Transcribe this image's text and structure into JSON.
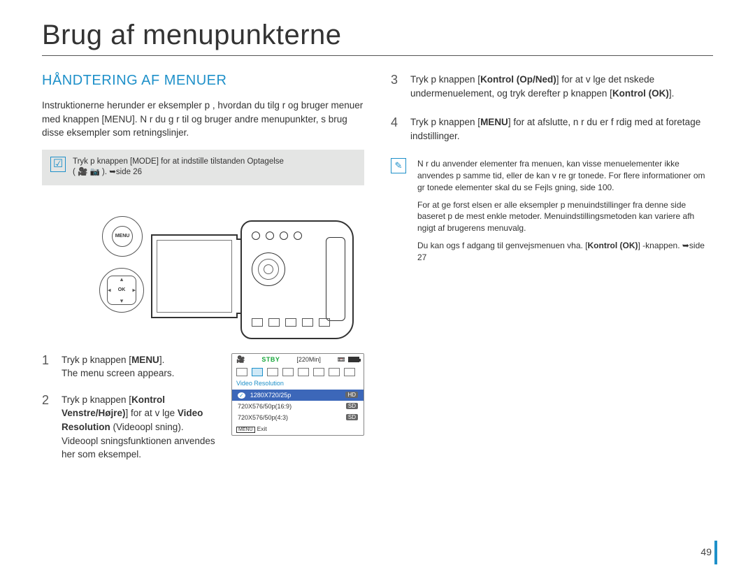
{
  "main_title": "Brug af menupunkterne",
  "section_head": "HÅNDTERING AF MENUER",
  "intro": "Instruktionerne herunder er eksempler p , hvordan du tilg r og bruger menuer med knappen [MENU]. N r du g r til og bruger andre menupunkter, s  brug disse eksempler som retningslinjer.",
  "gray_note": {
    "line1": "Tryk p  knappen [MODE] for at indstille tilstanden Optagelse",
    "line2": "( 🎥  📷 ). ➥side 26"
  },
  "illus": {
    "menu_label": "MENU",
    "ok_label": "OK"
  },
  "steps_left": {
    "s1_num": "1",
    "s1_a": "Tryk p  knappen [",
    "s1_b": "MENU",
    "s1_c": "].",
    "s1_sub": "The menu screen appears.",
    "s2_num": "2",
    "s2_a": "Tryk p  knappen [",
    "s2_b": "Kontrol Venstre/Højre)",
    "s2_c": "] for at v lge ",
    "s2_d": "Video Resolution",
    "s2_e": " (Videoopl sning).",
    "s2_sub": "Videoopl sningsfunktionen anvendes her som eksempel."
  },
  "mini_screen": {
    "stby": "STBY",
    "time": "[220Min]",
    "section": "Video Resolution",
    "items": [
      {
        "label": "1280X720/25p",
        "badge": "HD",
        "selected": true
      },
      {
        "label": "720X576/50p(16:9)",
        "badge": "SD",
        "selected": false
      },
      {
        "label": "720X576/50p(4:3)",
        "badge": "SD",
        "selected": false
      }
    ],
    "exit_menu": "MENU",
    "exit_label": "Exit"
  },
  "steps_right": {
    "s3_num": "3",
    "s3_a": "Tryk p  knappen [",
    "s3_b": "Kontrol (Op/Ned)",
    "s3_c": "] for at v lge det  nskede undermenuelement, og tryk derefter p  knappen [",
    "s3_d": "Kontrol (OK)",
    "s3_e": "].",
    "s4_num": "4",
    "s4_a": "Tryk p  knappen [",
    "s4_b": "MENU",
    "s4_c": "] for at afslutte, n r du er f rdig med at foretage indstillinger."
  },
  "right_note": {
    "p1": "N r du anvender elementer fra menuen, kan visse menuelementer ikke anvendes p  samme tid, eller de kan v re gr tonede. For flere informationer om gr tonede elementer skal du se Fejls gning, side 100.",
    "p2": "For at  ge forst elsen er alle eksempler p  menuindstillinger fra denne side baseret p  de mest enkle metoder. Menuindstillingsmetoden kan variere afh ngigt af brugerens menuvalg.",
    "p3a": "Du kan ogs  f  adgang til genvejsmenuen vha. [",
    "p3b": "Kontrol (OK)",
    "p3c": "] -knappen. ➥side 27"
  },
  "page_number": "49"
}
